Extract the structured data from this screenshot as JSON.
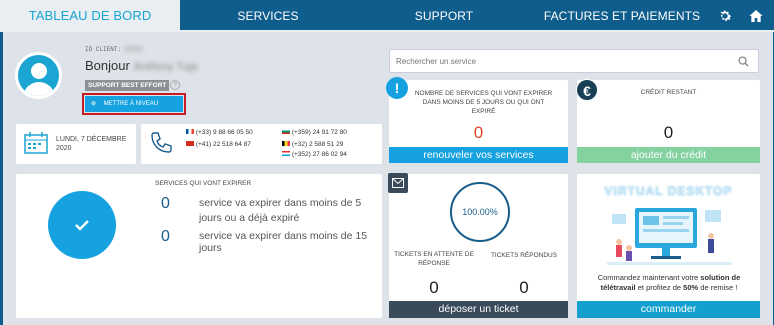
{
  "nav": {
    "tabs": [
      "TABLEAU DE BORD",
      "SERVICES",
      "SUPPORT",
      "FACTURES ET PAIEMENTS"
    ],
    "settings_icon": "gear-icon",
    "home_icon": "home-icon"
  },
  "profile": {
    "client_label": "ID CLIENT:",
    "client_id": "00000",
    "greeting": "Bonjour",
    "name": "Anthony Tuja",
    "badge": "SUPPORT BEST EFFORT",
    "upgrade_button": "METTRE À NIVEAU"
  },
  "date": {
    "text": "LUNDI, 7 DÉCEMBRE\n2020"
  },
  "phones": [
    {
      "flag": "fr",
      "number": "(+33) 9 88 66 05 50"
    },
    {
      "flag": "ch",
      "number": "(+41) 22 518 64 87"
    },
    {
      "flag": "bg",
      "number": "(+359) 24 91 72 80"
    },
    {
      "flag": "be",
      "number": "(+32) 2 588 51 29"
    },
    {
      "flag": "lu",
      "number": "(+352) 27 86 02 94"
    }
  ],
  "search": {
    "placeholder": "Rechercher un service"
  },
  "expiring_card": {
    "title": "NOMBRE DE SERVICES QUI VONT EXPIRER DANS MOINS DE 5 JOURS OU QUI ONT EXPIRÉ",
    "value": "0",
    "button": "renouveler vos services",
    "icon": "!"
  },
  "credit_card": {
    "title": "CRÉDIT RESTANT",
    "value": "0",
    "button": "ajouter du crédit",
    "icon": "€"
  },
  "services_expiring": {
    "title": "SERVICES QUI VONT EXPIRER",
    "rows": [
      {
        "count": "0",
        "text": "service va expirer dans moins de 5 jours ou a déjà expiré"
      },
      {
        "count": "0",
        "text": "service va expirer dans moins de 15 jours"
      }
    ]
  },
  "tickets": {
    "percent": "100.00%",
    "progress": 1.0,
    "waiting_label": "TICKETS EN ATTENTE DE RÉPONSE",
    "waiting_value": "0",
    "answered_label": "TICKETS RÉPONDUS",
    "answered_value": "0",
    "button": "déposer un ticket"
  },
  "promo": {
    "title": "VIRTUAL DESKTOP",
    "text_before": "Commandez maintenant votre ",
    "text_bold1": "solution de télétravail",
    "text_mid": " et profitez de ",
    "text_bold2": "50%",
    "text_after": " de remise !",
    "button": "commander"
  },
  "colors": {
    "nav": "#0e5d8c",
    "accent": "#1aa5d2",
    "blue_bar": "#16a2e0",
    "green_bar": "#83d2a0",
    "dark_bar": "#394b5b",
    "teal_bar": "#13a0cf",
    "red_value": "#e0442a"
  }
}
